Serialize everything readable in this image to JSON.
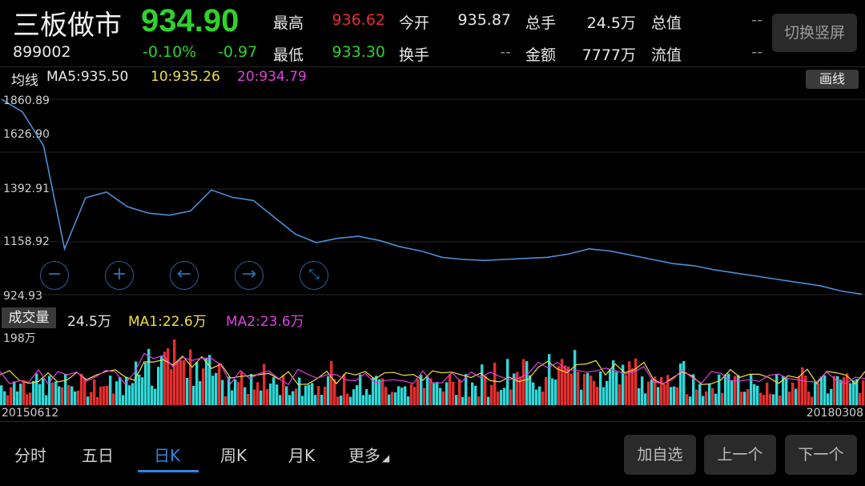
{
  "header": {
    "title": "三板做市",
    "code": "899002",
    "price": "934.90",
    "change_pct": "-0.10%",
    "change_abs": "-0.97",
    "stats": {
      "high_label": "最高",
      "high_value": "936.62",
      "low_label": "最低",
      "low_value": "933.30",
      "open_label": "今开",
      "open_value": "935.87",
      "turnover_label": "换手",
      "turnover_value": "--",
      "volume_label": "总手",
      "volume_value": "24.5万",
      "amount_label": "金额",
      "amount_value": "7777万",
      "total_cap_label": "总值",
      "total_cap_value": "--",
      "float_cap_label": "流值",
      "float_cap_value": "--"
    },
    "switch_label": "切换竖屏"
  },
  "ma": {
    "label": "均线",
    "ma5": "MA5:935.50",
    "ma10": "10:935.26",
    "ma20": "20:934.79",
    "draw_label": "画线"
  },
  "price_axis": [
    "1860.89",
    "1626.90",
    "1392.91",
    "1158.92",
    "924.93"
  ],
  "controls": [
    "zoom-out",
    "zoom-in",
    "left",
    "right",
    "collapse"
  ],
  "volume": {
    "tag": "成交量",
    "current": "24.5万",
    "ma1": "MA1:22.6万",
    "ma2": "MA2:23.6万",
    "max_label": "198万"
  },
  "dates": {
    "start": "20150612",
    "end": "20180308"
  },
  "tabs": [
    {
      "label": "分时"
    },
    {
      "label": "五日"
    },
    {
      "label": "日K"
    },
    {
      "label": "周K"
    },
    {
      "label": "月K"
    },
    {
      "label": "更多"
    }
  ],
  "active_tab": "日K",
  "buttons": {
    "add": "加自选",
    "prev": "上一个",
    "next": "下一个"
  },
  "colors": {
    "up": "#e62e2e",
    "down": "#2fd12f",
    "line": "#4a8fd6",
    "ma10": "#f0e040",
    "ma20": "#e040e0",
    "vol_down": "#2fd8d8",
    "accent": "#2f86e0"
  },
  "chart_data": {
    "type": "line",
    "x": [
      "20150612",
      "20180308"
    ],
    "ylim": [
      924.93,
      1860.89
    ],
    "series": [
      {
        "values": [
          1860.89,
          1800,
          1640,
          1150,
          1392.91,
          1420,
          1350,
          1320,
          1310,
          1330,
          1430,
          1395,
          1380,
          1300,
          1220,
          1180,
          1200,
          1210,
          1190,
          1160,
          1140,
          1110,
          1100,
          1095,
          1100,
          1105,
          1110,
          1125,
          1150,
          1140,
          1120,
          1100,
          1080,
          1070,
          1050,
          1035,
          1020,
          1005,
          990,
          975,
          950,
          934.9
        ]
      }
    ]
  }
}
